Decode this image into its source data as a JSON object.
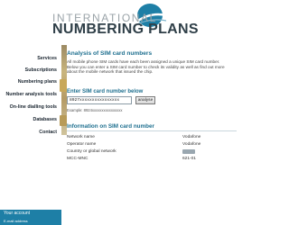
{
  "logo": {
    "line1": "INTERNATIONAL",
    "line2": "NUMBERING PLANS"
  },
  "sidebar": {
    "items": [
      {
        "label": "Services"
      },
      {
        "label": "Subscriptions"
      },
      {
        "label": "Numbering plans"
      },
      {
        "label": "Number analysis tools"
      },
      {
        "label": "On-line dialling tools"
      },
      {
        "label": "Databases"
      },
      {
        "label": "Contact"
      }
    ],
    "account_title": "Your account",
    "email_label": "E-mail address"
  },
  "main": {
    "heading": "Analysis of SIM card numbers",
    "intro": "All mobile phone SIM cards have each been assigned a unique SIM card number. Below you can enter a SIM card number to check its validity as well as find out more about the mobile network that issued the chip.",
    "enter_label": "Enter SIM card number below",
    "sim_value": "8927xxxxxxxxxxxxxxxx",
    "analyse_label": "analyse",
    "example": "Example: 8924xxxxxxxxxxxxxxxx",
    "info_heading": "Information on SIM card number",
    "info_rows": [
      {
        "label": "Network name",
        "value": "Vodafone"
      },
      {
        "label": "Operator name",
        "value": "Vodafone"
      },
      {
        "label": "Country or global network",
        "value": ""
      },
      {
        "label": "MCC-MNC",
        "value": "621-01"
      }
    ]
  },
  "colors": {
    "accent": "#1e6f8f",
    "account_box": "#1e7fa6"
  }
}
